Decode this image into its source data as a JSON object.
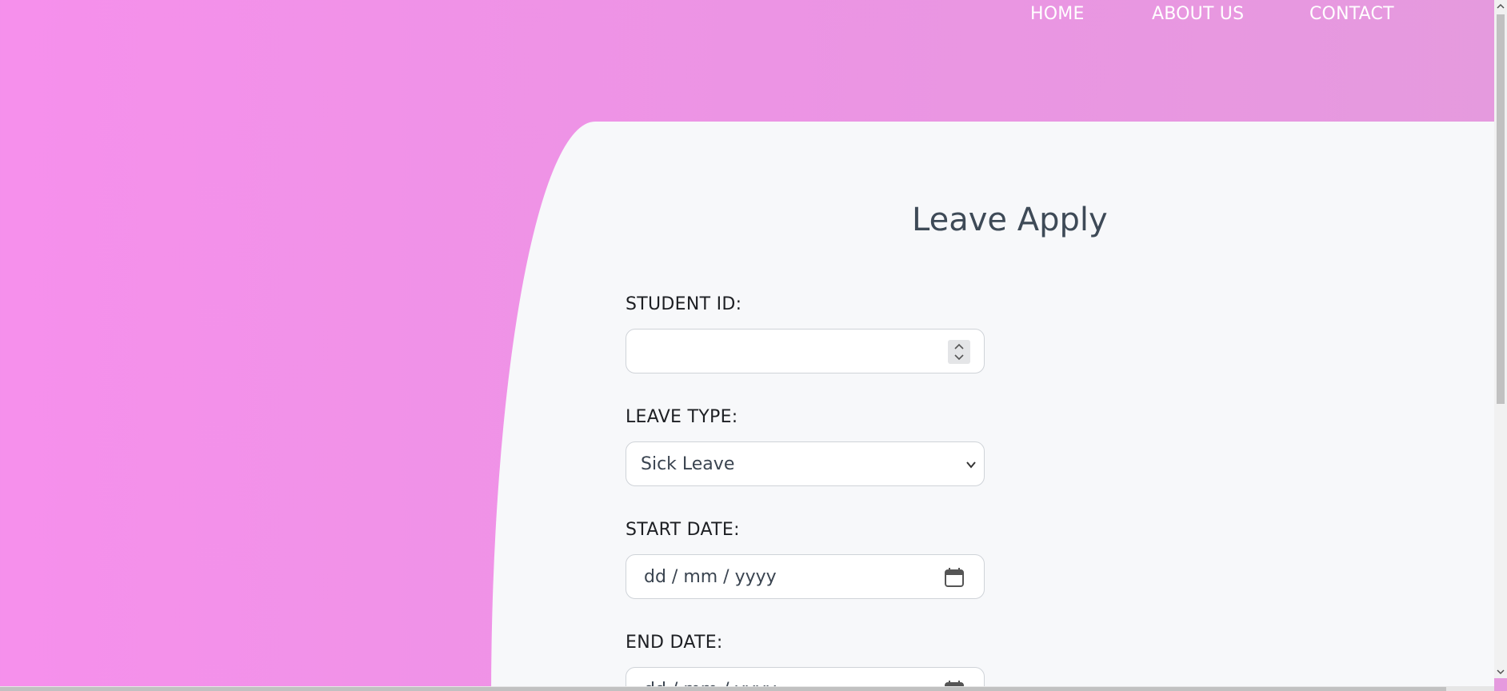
{
  "nav": {
    "home": "HOME",
    "about": "ABOUT US",
    "contact": "CONTACT"
  },
  "form": {
    "title": "Leave Apply",
    "student_id": {
      "label": "STUDENT ID:",
      "value": ""
    },
    "leave_type": {
      "label": "LEAVE TYPE:",
      "selected": "Sick Leave"
    },
    "start_date": {
      "label": "START DATE:",
      "placeholder": "dd / mm / yyyy"
    },
    "end_date": {
      "label": "END DATE:",
      "placeholder": "dd / mm / yyyy"
    }
  },
  "icons": {
    "spinner": "number-spinner-icon",
    "select": "chevron-down-icon",
    "calendar": "calendar-icon"
  },
  "colors": {
    "background_start": "#f690ec",
    "background_end": "#e59ade",
    "panel": "#f7f8fa",
    "title": "#3e4a57"
  }
}
